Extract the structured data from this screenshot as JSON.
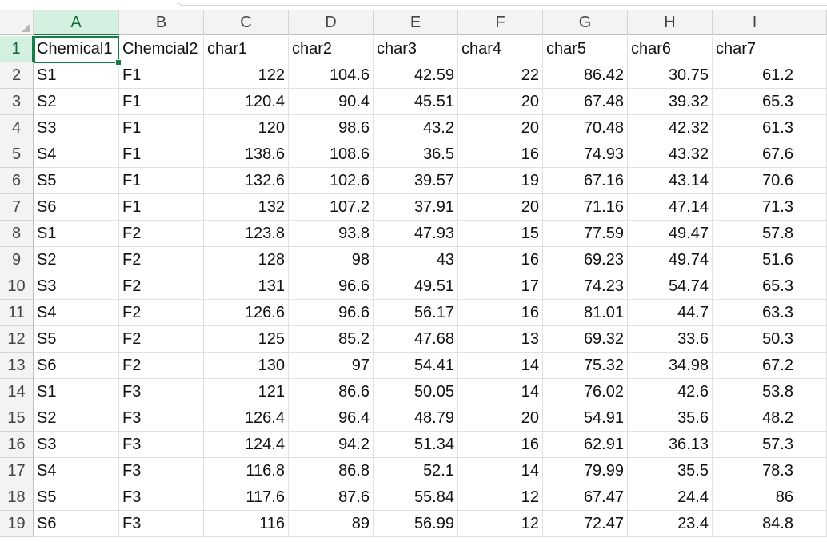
{
  "columns": [
    "A",
    "B",
    "C",
    "D",
    "E",
    "F",
    "G",
    "H",
    "I"
  ],
  "active_column": "A",
  "active_row": "1",
  "rows": [
    {
      "row": "1",
      "cells": [
        "Chemical1",
        "Chemcial2",
        "char1",
        "char2",
        "char3",
        "char4",
        "char5",
        "char6",
        "char7"
      ]
    },
    {
      "row": "2",
      "cells": [
        "S1",
        "F1",
        "122",
        "104.6",
        "42.59",
        "22",
        "86.42",
        "30.75",
        "61.2"
      ]
    },
    {
      "row": "3",
      "cells": [
        "S2",
        "F1",
        "120.4",
        "90.4",
        "45.51",
        "20",
        "67.48",
        "39.32",
        "65.3"
      ]
    },
    {
      "row": "4",
      "cells": [
        "S3",
        "F1",
        "120",
        "98.6",
        "43.2",
        "20",
        "70.48",
        "42.32",
        "61.3"
      ]
    },
    {
      "row": "5",
      "cells": [
        "S4",
        "F1",
        "138.6",
        "108.6",
        "36.5",
        "16",
        "74.93",
        "43.32",
        "67.6"
      ]
    },
    {
      "row": "6",
      "cells": [
        "S5",
        "F1",
        "132.6",
        "102.6",
        "39.57",
        "19",
        "67.16",
        "43.14",
        "70.6"
      ]
    },
    {
      "row": "7",
      "cells": [
        "S6",
        "F1",
        "132",
        "107.2",
        "37.91",
        "20",
        "71.16",
        "47.14",
        "71.3"
      ]
    },
    {
      "row": "8",
      "cells": [
        "S1",
        "F2",
        "123.8",
        "93.8",
        "47.93",
        "15",
        "77.59",
        "49.47",
        "57.8"
      ]
    },
    {
      "row": "9",
      "cells": [
        "S2",
        "F2",
        "128",
        "98",
        "43",
        "16",
        "69.23",
        "49.74",
        "51.6"
      ]
    },
    {
      "row": "10",
      "cells": [
        "S3",
        "F2",
        "131",
        "96.6",
        "49.51",
        "17",
        "74.23",
        "54.74",
        "65.3"
      ]
    },
    {
      "row": "11",
      "cells": [
        "S4",
        "F2",
        "126.6",
        "96.6",
        "56.17",
        "16",
        "81.01",
        "44.7",
        "63.3"
      ]
    },
    {
      "row": "12",
      "cells": [
        "S5",
        "F2",
        "125",
        "85.2",
        "47.68",
        "13",
        "69.32",
        "33.6",
        "50.3"
      ]
    },
    {
      "row": "13",
      "cells": [
        "S6",
        "F2",
        "130",
        "97",
        "54.41",
        "14",
        "75.32",
        "34.98",
        "67.2"
      ]
    },
    {
      "row": "14",
      "cells": [
        "S1",
        "F3",
        "121",
        "86.6",
        "50.05",
        "14",
        "76.02",
        "42.6",
        "53.8"
      ]
    },
    {
      "row": "15",
      "cells": [
        "S2",
        "F3",
        "126.4",
        "96.4",
        "48.79",
        "20",
        "54.91",
        "35.6",
        "48.2"
      ]
    },
    {
      "row": "16",
      "cells": [
        "S3",
        "F3",
        "124.4",
        "94.2",
        "51.34",
        "16",
        "62.91",
        "36.13",
        "57.3"
      ]
    },
    {
      "row": "17",
      "cells": [
        "S4",
        "F3",
        "116.8",
        "86.8",
        "52.1",
        "14",
        "79.99",
        "35.5",
        "78.3"
      ]
    },
    {
      "row": "18",
      "cells": [
        "S5",
        "F3",
        "117.6",
        "87.6",
        "55.84",
        "12",
        "67.47",
        "24.4",
        "86"
      ]
    },
    {
      "row": "19",
      "cells": [
        "S6",
        "F3",
        "116",
        "89",
        "56.99",
        "12",
        "72.47",
        "23.4",
        "84.8"
      ]
    }
  ],
  "colors": {
    "selection": "#137e43",
    "header_bg": "#f3f3f3",
    "active_header_bg": "#d3f0e0",
    "gridline": "#e1e1e1"
  }
}
